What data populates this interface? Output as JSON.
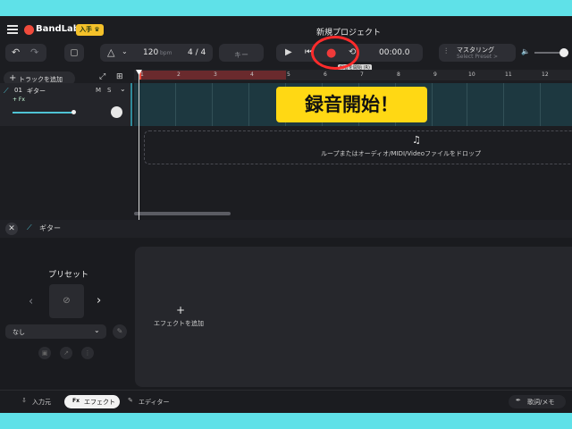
{
  "app": {
    "logo_text": "BandLab",
    "join_badge": "入手 ♛",
    "project_title": "新規プロジェクト"
  },
  "toolbar": {
    "undo_icon": "↶",
    "redo_icon": "↷",
    "metronome_icon": "△",
    "bpm_value": "120",
    "bpm_unit": "bpm",
    "time_sig": "4 / 4",
    "key_label": "キー",
    "play_icon": "▶",
    "skip_back_icon": "⏮",
    "record_icon": "●",
    "loop_icon": "⟲",
    "time_display": "00:00.0",
    "mastering_label": "マスタリング",
    "mastering_sub": "Select Preset >",
    "volume_icon": "🔈",
    "record_tooltip": "録音を開始 (R)"
  },
  "tracks": {
    "add_track_label": "トラックを追加",
    "track_number": "01",
    "track_name": "ギター",
    "m_label": "M",
    "s_label": "S",
    "fx_label": "+ Fx"
  },
  "ruler": [
    "1",
    "2",
    "3",
    "4",
    "5",
    "6",
    "7",
    "8",
    "9",
    "10",
    "11",
    "12"
  ],
  "drop_zone": {
    "text": "ループまたはオーディオ/MIDI/Videoファイルをドロップ"
  },
  "lower": {
    "track_name": "ギター",
    "preset_heading": "プリセット",
    "preset_value": "なし",
    "add_effect_label": "エフェクトを追加"
  },
  "bottom_tabs": {
    "input_label": "入力元",
    "effects_label": "エフェクト",
    "editor_label": "エディター",
    "lyrics_label": "歌詞/メモ"
  },
  "annotation": {
    "callout": "録音開始！"
  }
}
